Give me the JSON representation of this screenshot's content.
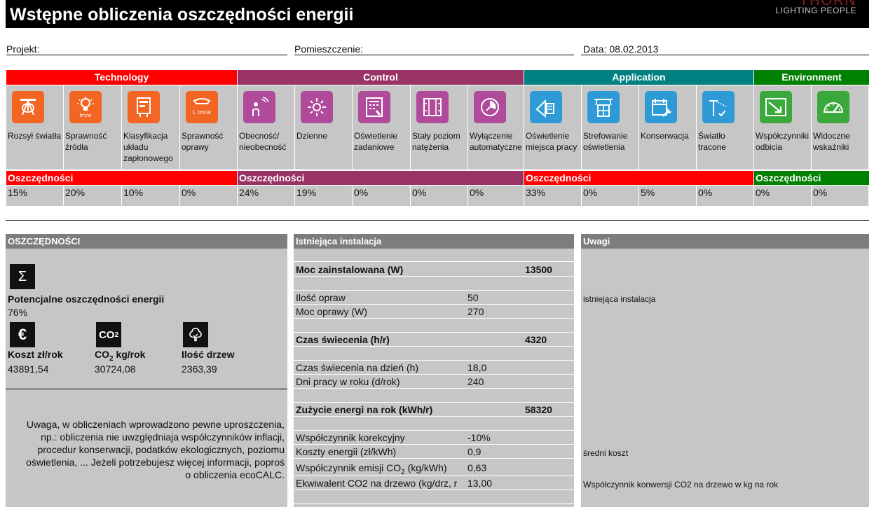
{
  "header": {
    "title": "Wstępne obliczenia oszczędności energii",
    "brand": "THORN",
    "tagline": "LIGHTING PEOPLE"
  },
  "info": {
    "project_label": "Projekt:",
    "room_label": "Pomieszczenie:",
    "date_label": "Data: 08.02.2013"
  },
  "categories": [
    {
      "name": "Technology",
      "color": "#ff0000"
    },
    {
      "name": "Control",
      "color": "#993366"
    },
    {
      "name": "Application",
      "color": "#008080"
    },
    {
      "name": "Environment",
      "color": "#008000"
    }
  ],
  "savings_label": "Oszczędności",
  "factors": [
    {
      "label": "Rozsył światła",
      "icon": "light-distribution-icon",
      "icon_color": "#f26522",
      "saving": "15%"
    },
    {
      "label": "Sprawność źródła",
      "icon": "lamp-efficiency-icon",
      "icon_color": "#f26522",
      "saving": "20%"
    },
    {
      "label": "Klasyfikacja układu zapłonowego",
      "icon": "ballast-class-icon",
      "icon_color": "#f26522",
      "saving": "10%"
    },
    {
      "label": "Sprawność oprawy",
      "icon": "luminaire-efficiency-icon",
      "icon_color": "#f26522",
      "saving": "0%"
    },
    {
      "label": "Obecność/ nieobecność",
      "icon": "presence-detection-icon",
      "icon_color": "#b04a9a",
      "saving": "24%"
    },
    {
      "label": "Dzienne",
      "icon": "daylight-icon",
      "icon_color": "#b04a9a",
      "saving": "19%"
    },
    {
      "label": "Oświetlenie zadaniowe",
      "icon": "task-lighting-icon",
      "icon_color": "#b04a9a",
      "saving": "0%"
    },
    {
      "label": "Stały poziom natężenia",
      "icon": "constant-illuminance-icon",
      "icon_color": "#b04a9a",
      "saving": "0%"
    },
    {
      "label": "Wyłączenie automatyczne",
      "icon": "auto-off-clock-icon",
      "icon_color": "#b04a9a",
      "saving": "0%"
    },
    {
      "label": "Oświetlenie miejsca pracy",
      "icon": "workplace-lighting-icon",
      "icon_color": "#2f9bd6",
      "saving": "33%"
    },
    {
      "label": "Strefowanie oświetlenia",
      "icon": "zoning-icon",
      "icon_color": "#2f9bd6",
      "saving": "0%"
    },
    {
      "label": "Konserwacja",
      "icon": "maintenance-icon",
      "icon_color": "#2f9bd6",
      "saving": "5%"
    },
    {
      "label": "Światło tracone",
      "icon": "wasted-light-icon",
      "icon_color": "#2f9bd6",
      "saving": "0%"
    },
    {
      "label": "Współczynniki odbicia",
      "icon": "reflectance-icon",
      "icon_color": "#3aa83a",
      "saving": "0%"
    },
    {
      "label": "Widoczne wskaźniki",
      "icon": "visible-meter-icon",
      "icon_color": "#3aa83a",
      "saving": "0%"
    }
  ],
  "summary": {
    "heading": "OSZCZĘDNOŚCI",
    "sigma": "Σ",
    "potential_label": "Potencjalne oszczędności energii",
    "potential_value": "76%",
    "euro_symbol": "€",
    "cost_label": "Koszt zł/rok",
    "cost_value": "43891,54",
    "co2_badge_main": "CO",
    "co2_badge_sub": "2",
    "co2_label_main": "CO",
    "co2_label_sub": "2",
    "co2_label_rest": " kg/rok",
    "co2_value": "30724,08",
    "trees_label": "Ilość drzew",
    "trees_value": "2363,39",
    "disclaimer": [
      "Uwaga, w obliczeniach wprowadzono pewne uproszczenia,",
      "np.: obliczenia nie uwzględniaja współczynników inflacji,",
      "procedur konserwacji, podatków ekologicznych, poziomu",
      "oświetlenia, ... Jeżeli potrzebujesz więcej informacji, poproś",
      "o obliczenia  ecoCALC."
    ]
  },
  "installation": {
    "heading": "Istniejąca instalacja",
    "installed_power_label": "Moc zainstalowana (W)",
    "installed_power_value": "13500",
    "luminaires_label": "Ilość opraw",
    "luminaires_value": "50",
    "luminaire_power_label": "Moc oprawy (W)",
    "luminaire_power_value": "270",
    "burn_time_label": "Czas świecenia (h/r)",
    "burn_time_value": "4320",
    "daily_time_label": "Czas świecenia na dzień (h)",
    "daily_time_value": "18,0",
    "work_days_label": "Dni pracy w roku (d/rok)",
    "work_days_value": "240",
    "energy_label": "Zużycie energi na rok (kWh/r)",
    "energy_value": "58320",
    "correction_label": "Współczynnik korekcyjny",
    "correction_value": "-10%",
    "energy_cost_label": "Koszty energii (zł/kWh)",
    "energy_cost_value": "0,9",
    "emission_label_main": "Współczynnik emisji CO",
    "emission_label_sub": "2",
    "emission_label_rest": " (kg/kWh)",
    "emission_value": "0,63",
    "tree_eq_label": "Ekwiwalent CO2 na drzewo (kg/drz, r",
    "tree_eq_value": "13,00"
  },
  "remarks": {
    "heading": "Uwagi",
    "existing_note": "istniejąca instalacja",
    "cost_note": "średni koszt",
    "tree_note": "Współczynnik konwersji CO2 na drzewo w kg na rok"
  }
}
